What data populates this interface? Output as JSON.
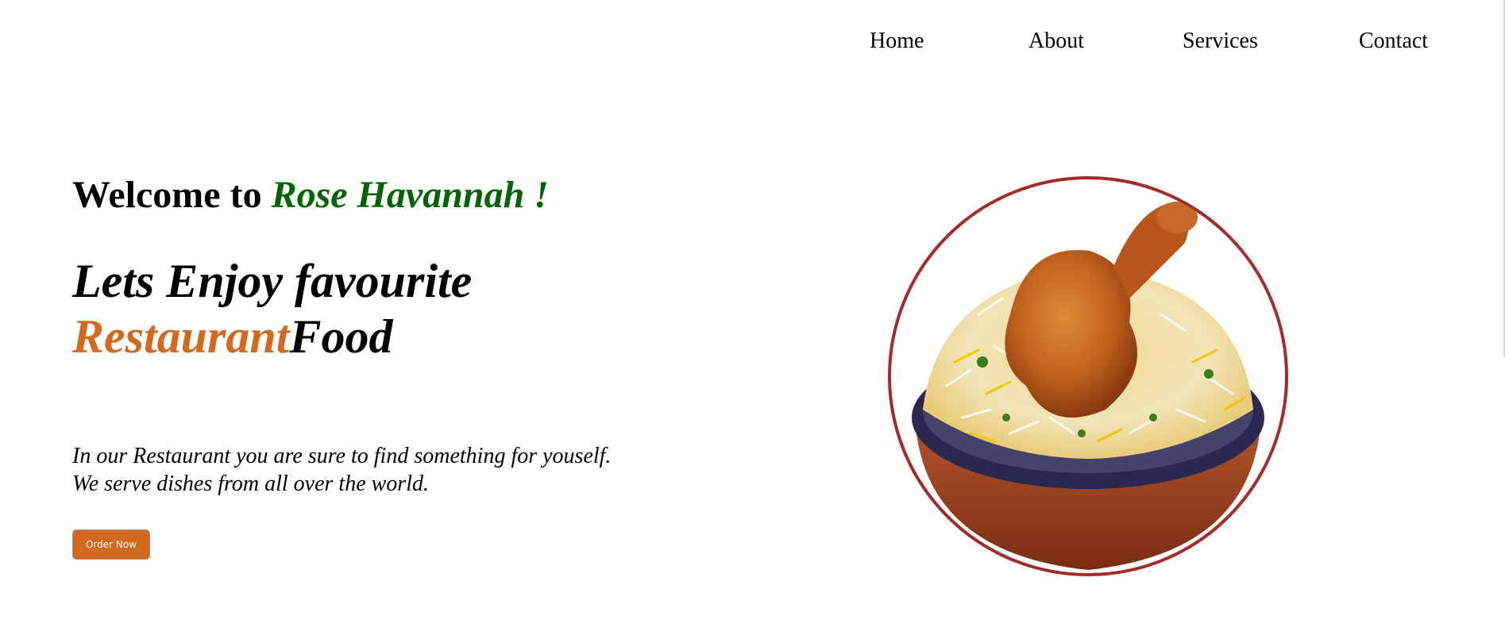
{
  "nav": {
    "items": [
      {
        "label": "Home"
      },
      {
        "label": "About"
      },
      {
        "label": "Services"
      },
      {
        "label": "Contact"
      }
    ]
  },
  "hero": {
    "welcome_prefix": "Welcome to ",
    "brand_name": "Rose Havannah !",
    "tagline_line1": "Lets Enjoy favourite",
    "tagline_accent": "Restaurant",
    "tagline_rest": "Food",
    "description_line1": "In our Restaurant you are sure to find something for youself.",
    "description_line2": "We serve dishes from all over the world.",
    "order_button": "Order Now"
  },
  "image": {
    "name": "biryani-bowl"
  },
  "colors": {
    "brand_green": "#006400",
    "accent_orange": "#d2691e",
    "image_border": "#a52a2a"
  }
}
